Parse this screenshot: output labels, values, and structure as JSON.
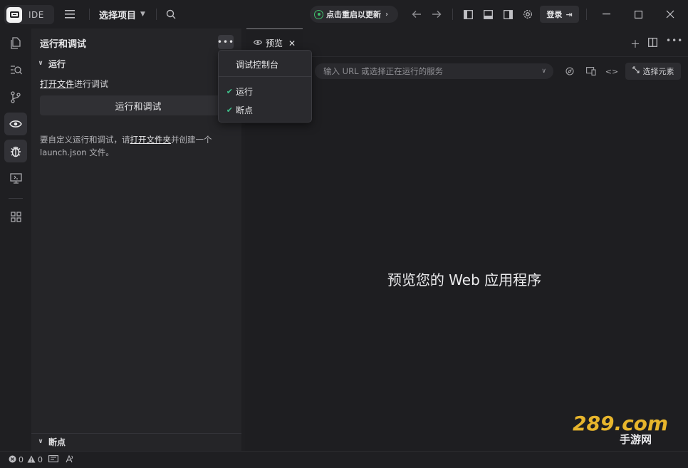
{
  "titlebar": {
    "app_label": "IDE",
    "project": "选择项目",
    "update": "点击重启以更新",
    "login": "登录"
  },
  "sidebar": {
    "title": "运行和调试",
    "run_section": "运行",
    "open_file_link": "打开文件",
    "open_file_suffix": "进行调试",
    "run_button": "运行和调试",
    "hint_prefix": "要自定义运行和调试，请",
    "hint_link": "打开文件夹",
    "hint_suffix": "并创建一个 launch.json 文件。",
    "breakpoints_section": "断点"
  },
  "menu": {
    "items": [
      {
        "label": "调试控制台",
        "checked": false
      },
      {
        "label": "运行",
        "checked": true
      },
      {
        "label": "断点",
        "checked": true
      }
    ]
  },
  "editor": {
    "tab_label": "预览",
    "url_placeholder": "输入 URL 或选择正在运行的服务",
    "select_element": "选择元素",
    "empty_message": "预览您的 Web 应用程序"
  },
  "statusbar": {
    "errors": "0",
    "warnings": "0"
  },
  "watermark": {
    "main": "289.com",
    "sub": "手游网"
  },
  "colors": {
    "accent_green": "#3fbf6a",
    "background": "#1e1e21"
  }
}
